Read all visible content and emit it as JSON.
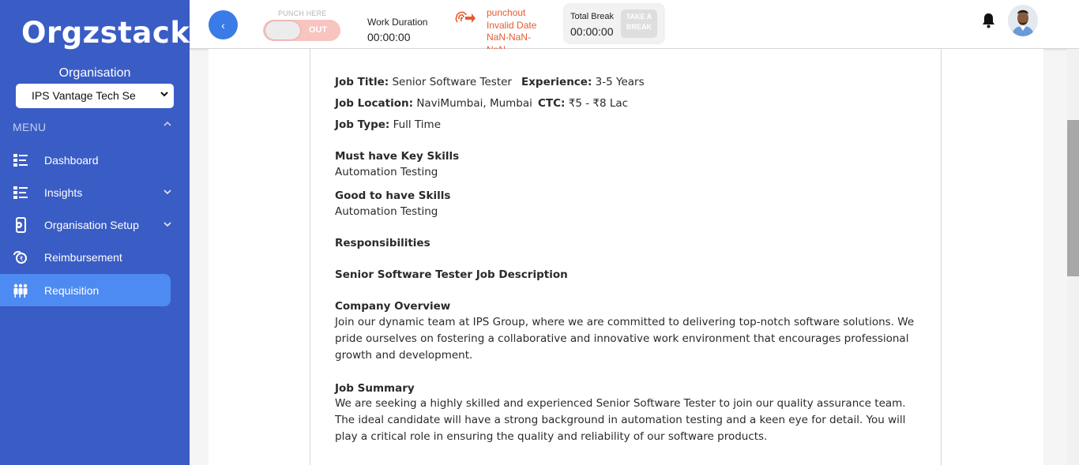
{
  "sidebar": {
    "logo": "Orgzstack",
    "org_label": "Organisation",
    "org_select_value": "IPS Vantage Tech Se",
    "menu_label": "MENU",
    "items": [
      {
        "label": "Dashboard",
        "icon": "dashboard-list-icon",
        "has_arrow": false
      },
      {
        "label": "Insights",
        "icon": "insights-list-icon",
        "has_arrow": true
      },
      {
        "label": "Organisation Setup",
        "icon": "org-setup-icon",
        "has_arrow": true
      },
      {
        "label": "Reimbursement",
        "icon": "reimbursement-icon",
        "has_arrow": false
      },
      {
        "label": "Requisition",
        "icon": "requisition-people-icon",
        "has_arrow": false,
        "active": true
      }
    ]
  },
  "header": {
    "back_label": "‹",
    "punch_label": "PUNCH HERE",
    "punch_state": "OUT",
    "work_duration_label": "Work Duration",
    "work_duration_value": "00:00:00",
    "punchout_line1": "punchout",
    "punchout_line2": "Invalid Date",
    "punchout_line3": "NaN-NaN-",
    "punchout_line4": "NaN",
    "total_break_label": "Total Break",
    "total_break_value": "00:00:00",
    "take_break_line1": "TAKE A",
    "take_break_line2": "BREAK"
  },
  "job": {
    "title_label": "Job Title:",
    "title_value": "Senior Software Tester",
    "experience_label": "Experience:",
    "experience_value": "3-5 Years",
    "location_label": "Job Location:",
    "location_value": "NaviMumbai, Mumbai",
    "ctc_label": "CTC:",
    "ctc_value": "₹5 - ₹8 Lac",
    "type_label": "Job Type:",
    "type_value": "Full Time",
    "must_skills_title": "Must have Key Skills",
    "must_skills_value": "Automation Testing",
    "good_skills_title": "Good to have Skills",
    "good_skills_value": "Automation Testing",
    "responsibilities_title": "Responsibilities",
    "jd_title": "Senior Software Tester Job Description",
    "company_overview_title": "Company Overview",
    "company_overview_body": "Join our dynamic team at IPS Group, where we are committed to delivering top-notch software solutions. We pride ourselves on fostering a collaborative and innovative work environment that encourages professional growth and development.",
    "job_summary_title": "Job Summary",
    "job_summary_body": "We are seeking a highly skilled and experienced Senior Software Tester to join our quality assurance team. The ideal candidate will have a strong background in automation testing and a keen eye for detail. You will play a critical role in ensuring the quality and reliability of our software products."
  },
  "colors": {
    "sidebar_bg": "#3a5cc5",
    "active_item": "#4d8bf2",
    "punchout_text": "#e85a2e",
    "back_button": "#3a7be8"
  }
}
